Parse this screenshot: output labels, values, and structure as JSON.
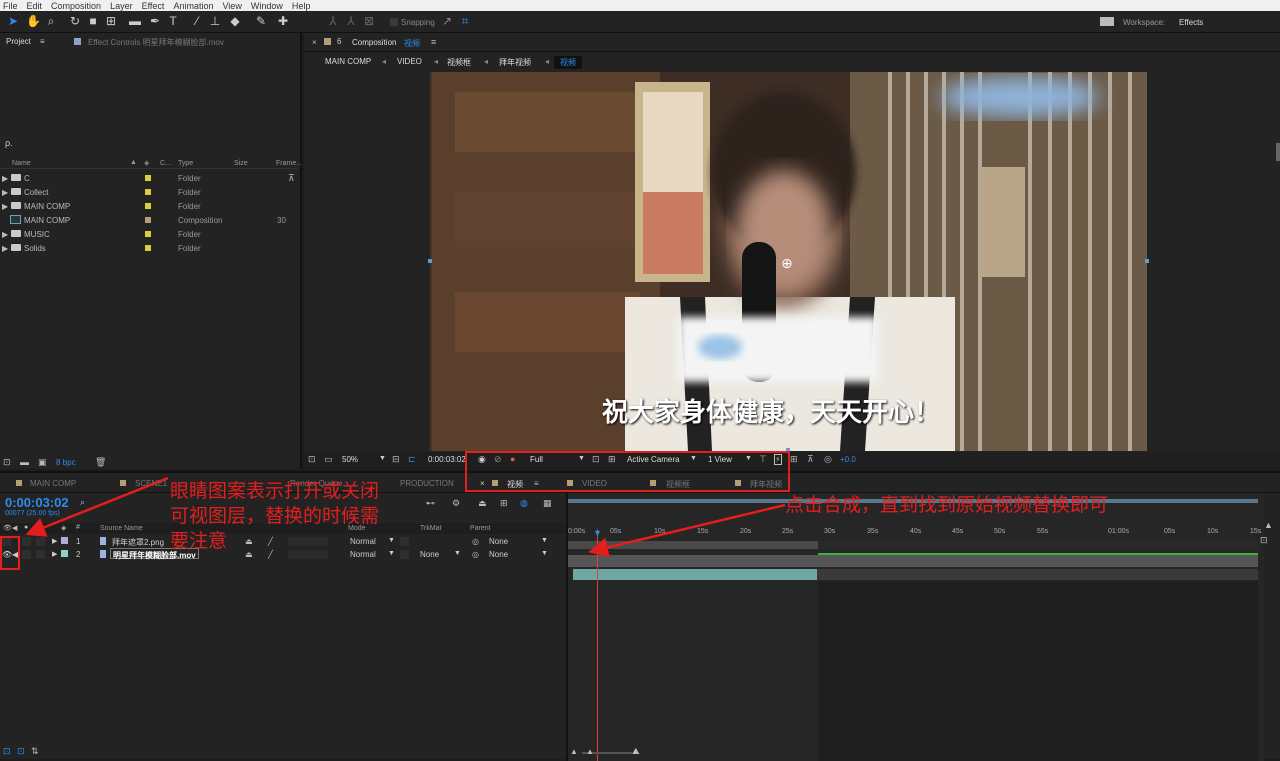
{
  "menu": [
    "File",
    "Edit",
    "Composition",
    "Layer",
    "Effect",
    "Animation",
    "View",
    "Window",
    "Help"
  ],
  "toolbar": {
    "snapping": "Snapping",
    "workspace_label": "Workspace:",
    "workspace_value": "Effects"
  },
  "project": {
    "tab_project": "Project",
    "tab_effect": "Effect Controls 明星拜年模糊脸部.mov",
    "search_placeholder": "ρ.",
    "columns": {
      "name": "Name",
      "c": "C...",
      "type": "Type",
      "size": "Size",
      "frame": "Frame..."
    },
    "items": [
      {
        "name": "C",
        "type": "Folder",
        "frame": ""
      },
      {
        "name": "Collect",
        "type": "Folder",
        "frame": ""
      },
      {
        "name": "MAIN COMP",
        "type": "Folder",
        "frame": ""
      },
      {
        "name": "MAIN COMP",
        "type": "Composition",
        "frame": "30"
      },
      {
        "name": "MUSIC",
        "type": "Folder",
        "frame": ""
      },
      {
        "name": "Solids",
        "type": "Folder",
        "frame": ""
      }
    ],
    "bpc": "8 bpc"
  },
  "composition": {
    "tab": "Composition",
    "tab_name": "视频",
    "breadcrumbs": [
      "MAIN COMP",
      "VIDEO",
      "视频框",
      "拜年视频",
      "视频"
    ],
    "subtitle": "祝大家身体健康，天天开心！",
    "zoom": "50%",
    "timecode": "0:00:03:02",
    "resolution": "Full",
    "camera": "Active Camera",
    "views": "1 View",
    "exposure": "+0.0"
  },
  "timeline": {
    "tabs": [
      "MAIN COMP",
      "SCENE1",
      "",
      "Render Queue",
      "PRODUCTION",
      "视频",
      "VIDEO",
      "视频框",
      "拜年视频"
    ],
    "timecode": "0:00:03:02",
    "frames": "00077 (25.00 fps)",
    "col_source": "Source Name",
    "col_mode": "Mode",
    "col_trkmat": "TrkMat",
    "col_parent": "Parent",
    "layers": [
      {
        "num": "1",
        "name": "拜年遮罩2.png",
        "mode": "Normal",
        "trk": "",
        "parent": "None"
      },
      {
        "num": "2",
        "name": "明星拜年模糊脸部.mov",
        "mode": "Normal",
        "trk": "None",
        "parent": "None"
      }
    ],
    "ruler": [
      "0:00s",
      "05s",
      "10s",
      "15s",
      "20s",
      "25s",
      "30s",
      "35s",
      "40s",
      "45s",
      "50s",
      "55s",
      "01:00s",
      "05s",
      "10s",
      "15s",
      "20s"
    ]
  },
  "annotations": {
    "left": "眼睛图案表示打开或关闭\n可视图层，替换的时候需\n要注意",
    "right": "点击合成，直到找到原始视频替换即可"
  },
  "colors": {
    "accent": "#2d8ceb",
    "annotation": "#e41e1e",
    "label_yellow": "#d9d13a",
    "layer_teal": "#6fa8a3"
  }
}
